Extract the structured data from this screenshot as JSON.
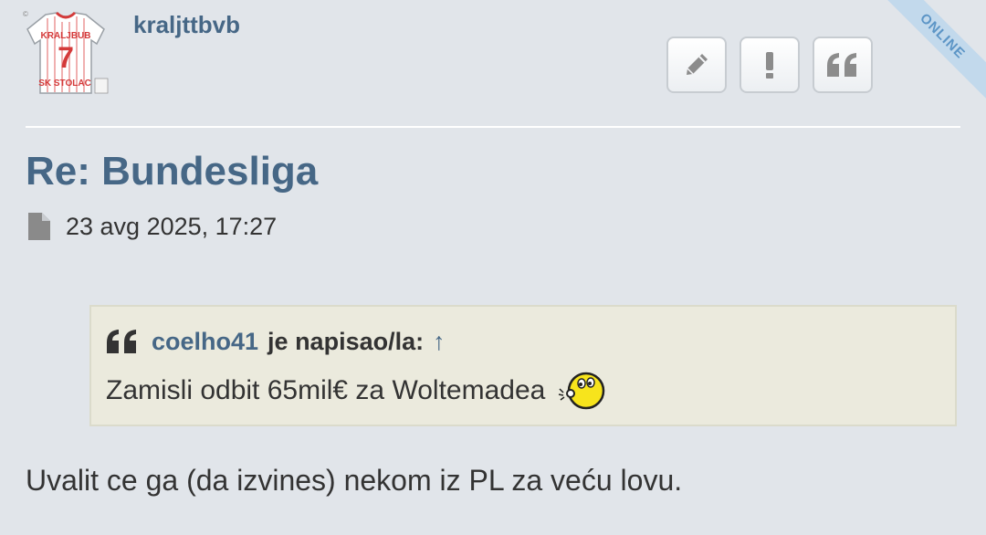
{
  "author": {
    "username": "kraljttbvb",
    "avatar_icon": "football-jersey-avatar",
    "avatar_text_top": "KRALJBUB",
    "avatar_number": "7",
    "avatar_text_bottom": "SK STOLAC",
    "status": "ONLINE"
  },
  "actions": [
    {
      "name": "edit-button",
      "icon": "pencil-icon"
    },
    {
      "name": "report-button",
      "icon": "exclamation-icon"
    },
    {
      "name": "quote-button",
      "icon": "quote-icon"
    }
  ],
  "post": {
    "title": "Re: Bundesliga",
    "date": "23 avg 2025, 17:27",
    "date_icon": "file-icon",
    "body": "Uvalit ce ga (da izvines) nekom iz PL za veću lovu."
  },
  "quote": {
    "author": "coelho41",
    "wrote_label": "je napisao/la:",
    "arrow": "↑",
    "text": "Zamisli odbit 65mil€ za Woltemadea",
    "smiley_icon": "whistling-smiley-icon"
  },
  "colors": {
    "background": "#e1e5ea",
    "link": "#466786",
    "quote_bg": "#ebeadd",
    "online_ribbon": "#c2d9ec"
  }
}
